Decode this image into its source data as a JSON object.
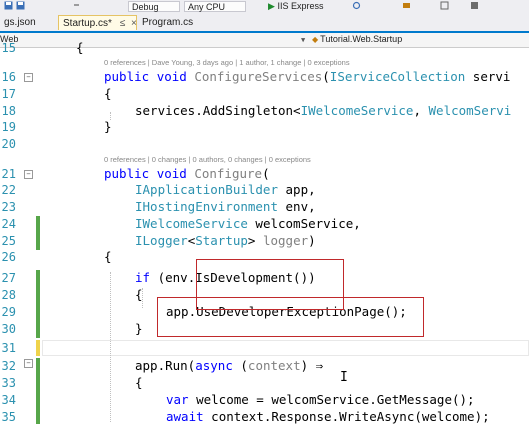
{
  "toolbar": {
    "config_label": "Debug",
    "platform_label": "Any CPU",
    "run_label": "IIS Express"
  },
  "tabs": [
    {
      "label": "gs.json",
      "active": false
    },
    {
      "label": "Startup.cs*",
      "active": true,
      "pin": "≤",
      "close": "×"
    },
    {
      "label": "Program.cs",
      "active": false
    }
  ],
  "navbar": {
    "project": "Web",
    "type": "Tutorial.Web.Startup"
  },
  "line_numbers": [
    "15",
    "16",
    "17",
    "18",
    "19",
    "20",
    "21",
    "22",
    "23",
    "24",
    "25",
    "26",
    "27",
    "28",
    "29",
    "30",
    "31",
    "32",
    "33",
    "34",
    "35"
  ],
  "codelens": {
    "configure_services": "0 references | Dave Young, 3 days ago | 1 author, 1 change | 0 exceptions",
    "configure": "0 references | 0 changes | 0 authors, 0 changes | 0 exceptions"
  },
  "code": {
    "l15": "{",
    "l16_kw1": "public",
    "l16_kw2": "void",
    "l16_name": "ConfigureServices",
    "l16_paren": "(",
    "l16_type": "IServiceCollection",
    "l16_param": " servi",
    "l17": "{",
    "l18_a": "services.AddSingleton<",
    "l18_t1": "IWelcomeService",
    "l18_c": ", ",
    "l18_t2": "WelcomServi",
    "l19": "}",
    "l21_kw1": "public",
    "l21_kw2": "void",
    "l21_name": "Configure",
    "l21_paren": "(",
    "l22_type": "IApplicationBuilder",
    "l22_rest": " app,",
    "l23_type": "IHostingEnvironment",
    "l23_rest": " env,",
    "l24_type": "IWelcomeService",
    "l24_rest": " welcomService,",
    "l25_type": "ILogger",
    "l25_lt": "<",
    "l25_type2": "Startup",
    "l25_gt": "> ",
    "l25_rest": "logger",
    "l25_end": ")",
    "l26": "{",
    "l27_kw": "if",
    "l27_rest": " (env.IsDevelopment())",
    "l28": "{",
    "l29": "app.UseDeveloperExceptionPage();",
    "l30": "}",
    "l32_a": "app.Run(",
    "l32_kw": "async",
    "l32_b": " (",
    "l32_c": "context",
    "l32_d": ") ⇒",
    "l33": "{",
    "l34_kw": "var",
    "l34_rest": " welcome = welcomService.GetMessage();",
    "l35_kw": "await",
    "l35_rest": " context.Response.WriteAsync(welcome);"
  }
}
